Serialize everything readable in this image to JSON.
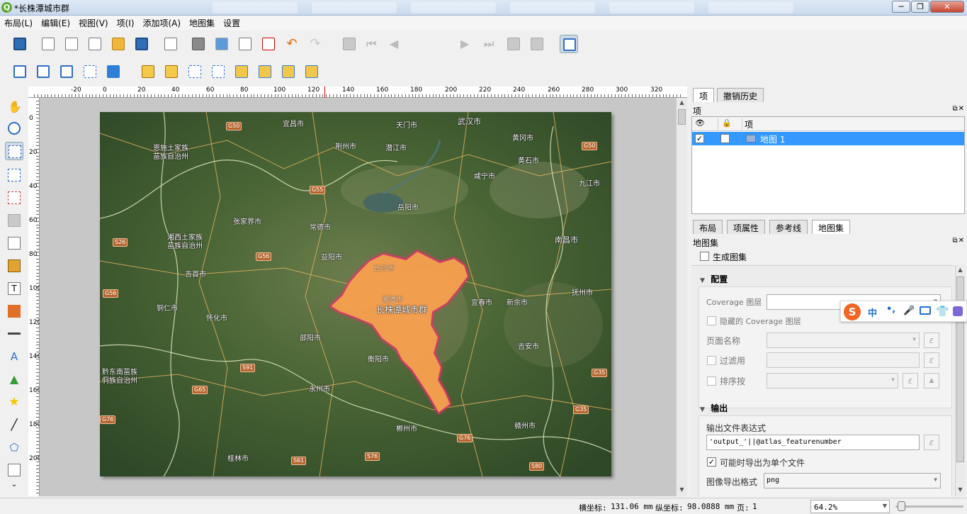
{
  "window": {
    "title": "*长株潭城市群",
    "app_icon": "qgis-icon",
    "controls": [
      "─",
      "❐",
      "✕"
    ]
  },
  "menu": [
    "布局(L)",
    "编辑(E)",
    "视图(V)",
    "项(I)",
    "添加项(A)",
    "地图集",
    "设置"
  ],
  "toolbar": {
    "page_value": "1"
  },
  "ruler_h": [
    "-20",
    "0",
    "20",
    "40",
    "60",
    "80",
    "100",
    "120",
    "140",
    "160",
    "180",
    "200",
    "220",
    "240",
    "260",
    "280",
    "300",
    "320"
  ],
  "ruler_v": [
    "0",
    "20",
    "40",
    "60",
    "80",
    "100",
    "120",
    "140",
    "160",
    "180",
    "200"
  ],
  "map": {
    "cities": [
      "宜昌市",
      "天门市",
      "武汉市",
      "荆州市",
      "潜江市",
      "黄冈市",
      "黄石市",
      "咸宁市",
      "九江市",
      "岳阳市",
      "张家界市",
      "常德市",
      "益阳市",
      "南昌市",
      "吉首市",
      "长沙市",
      "湘潭市",
      "宜春市",
      "新余市",
      "抚州市",
      "铜仁市",
      "怀化市",
      "邵阳市",
      "吉安市",
      "衡阳市",
      "永州市",
      "郴州市",
      "赣州市",
      "桂林市"
    ],
    "regions": [
      "恩施土家族\n苗族自治州",
      "湘西土家族\n苗族自治州",
      "黔东南苗族\n侗族自治州"
    ],
    "roads": [
      "G50",
      "G55",
      "S26",
      "G56",
      "G56",
      "S91",
      "G65",
      "S61",
      "G35",
      "G35",
      "G76",
      "S80",
      "G76",
      "S76",
      "G50"
    ],
    "highlight_label": "长株潭城市群",
    "highlight_color": "#f5b04a",
    "highlight_outline": "#e8316e"
  },
  "right_panel": {
    "top_tabs": [
      "项",
      "撤销历史"
    ],
    "items_title": "项",
    "items_header": "项",
    "items": [
      {
        "visible": "✓",
        "locked": "",
        "name": "地图 1"
      }
    ],
    "mid_tabs": [
      "布局",
      "项属性",
      "参考线",
      "地图集"
    ],
    "atlas_title": "地图集",
    "generate_label": "生成图集",
    "config_header": "配置",
    "coverage_label": "Coverage 图层",
    "hidden_coverage_label": "隐藏的 Coverage 图层",
    "page_name_label": "页面名称",
    "filter_label": "过滤用",
    "sort_label": "排序按",
    "output_header": "输出",
    "output_expr_label": "输出文件表达式",
    "output_expr_value": "'output_'||@atlas_featurenumber",
    "single_file_label": "可能时导出为单个文件",
    "single_file_checked": "✓",
    "image_format_label": "图像导出格式",
    "image_format_value": "png"
  },
  "status": {
    "x_label": "横坐标:",
    "x_value": "131.06 mm",
    "y_label": "纵坐标:",
    "y_value": "98.0888 mm",
    "page_label": "页:",
    "page_value": "1",
    "zoom": "64.2%"
  }
}
